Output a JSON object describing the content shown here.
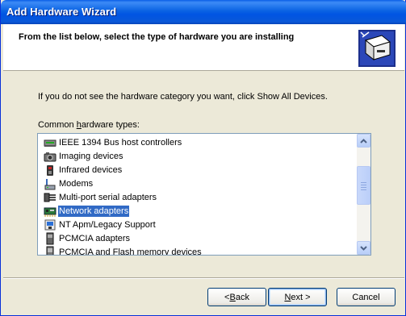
{
  "window": {
    "title": "Add Hardware Wizard"
  },
  "header": {
    "heading": "From the list below, select the type of hardware you are installing",
    "icon": "hardware-wizard-icon"
  },
  "instructions": "If you do not see the hardware category you want, click Show All Devices.",
  "list": {
    "label_prefix": "Common ",
    "label_accel": "h",
    "label_suffix": "ardware types:",
    "items": [
      {
        "label": "IEEE 1394 Bus host controllers",
        "icon": "ieee1394-icon"
      },
      {
        "label": "Imaging devices",
        "icon": "camera-icon"
      },
      {
        "label": "Infrared devices",
        "icon": "infrared-icon"
      },
      {
        "label": "Modems",
        "icon": "modem-icon"
      },
      {
        "label": "Multi-port serial adapters",
        "icon": "serial-port-icon"
      },
      {
        "label": "Network adapters",
        "icon": "network-adapter-icon",
        "selected": true
      },
      {
        "label": "NT Apm/Legacy Support",
        "icon": "power-icon"
      },
      {
        "label": "PCMCIA adapters",
        "icon": "pcmcia-icon"
      },
      {
        "label": "PCMCIA and Flash memory devices",
        "icon": "flash-memory-icon"
      }
    ]
  },
  "buttons": {
    "back_accel": "B",
    "back_rest": "ack",
    "next_accel": "N",
    "next_rest": "ext >",
    "back_prefix": "< ",
    "cancel": "Cancel"
  },
  "colors": {
    "selection": "#316AC5",
    "titlebar": "#0054E3"
  }
}
